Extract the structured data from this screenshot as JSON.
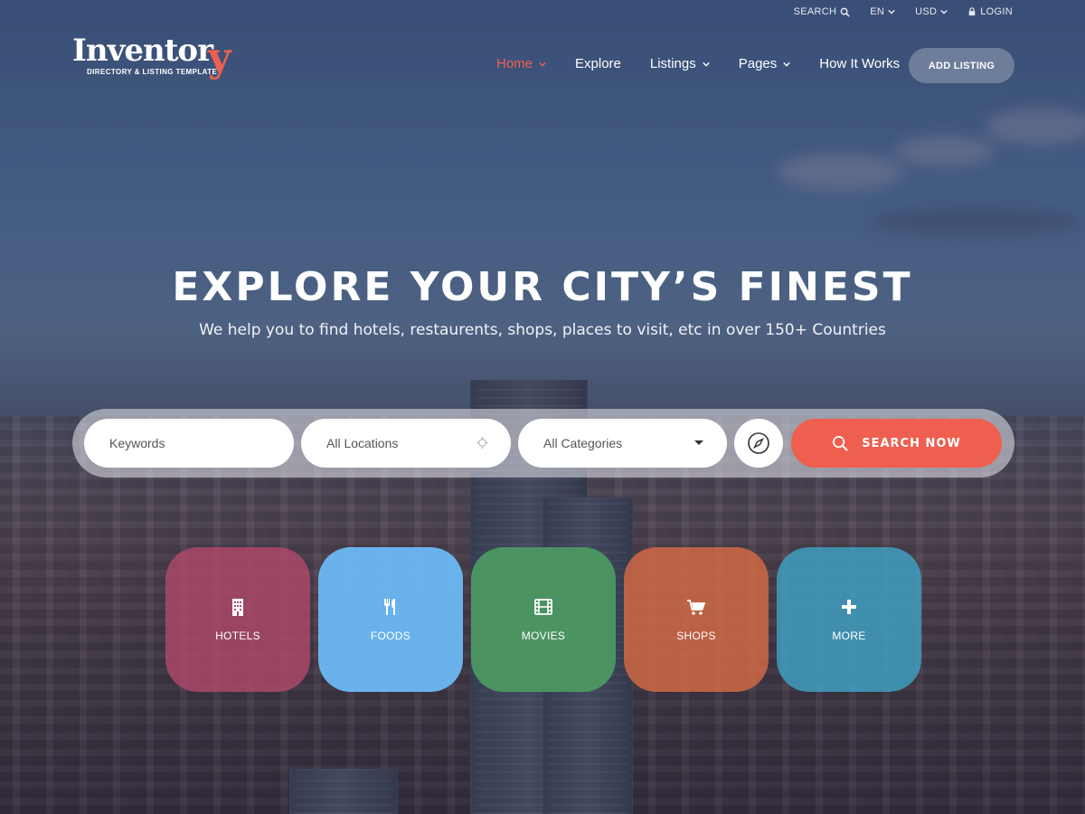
{
  "topbar": {
    "search_label": "SEARCH",
    "language": "EN",
    "currency": "USD",
    "login_label": "LOGIN"
  },
  "logo": {
    "word": "Inventor",
    "word_end": "y",
    "tagline": "DIRECTORY & LISTING TEMPLATE"
  },
  "nav": {
    "items": [
      {
        "label": "Home",
        "active": true,
        "dropdown": true
      },
      {
        "label": "Explore",
        "active": false,
        "dropdown": false
      },
      {
        "label": "Listings",
        "active": false,
        "dropdown": true
      },
      {
        "label": "Pages",
        "active": false,
        "dropdown": true
      },
      {
        "label": "How It Works",
        "active": false,
        "dropdown": false
      }
    ],
    "add_listing_label": "ADD LISTING"
  },
  "hero": {
    "title": "EXPLORE YOUR CITY’S FINEST",
    "subtitle": "We help you to find hotels, restaurents, shops, places to visit, etc in over 150+ Countries"
  },
  "search": {
    "keywords_placeholder": "Keywords",
    "location_value": "All Locations",
    "category_value": "All Categories",
    "button_label": "SEARCH NOW"
  },
  "categories": [
    {
      "label": "HOTELS",
      "icon": "building-icon",
      "color": "#b4496c"
    },
    {
      "label": "FOODS",
      "icon": "cutlery-icon",
      "color": "#6cb8f4"
    },
    {
      "label": "MOVIES",
      "icon": "film-icon",
      "color": "#4c9a62"
    },
    {
      "label": "SHOPS",
      "icon": "cart-icon",
      "color": "#d66a44"
    },
    {
      "label": "MORE",
      "icon": "plus-icon",
      "color": "#3f9dbf"
    }
  ],
  "colors": {
    "accent": "#ef5f4f"
  }
}
